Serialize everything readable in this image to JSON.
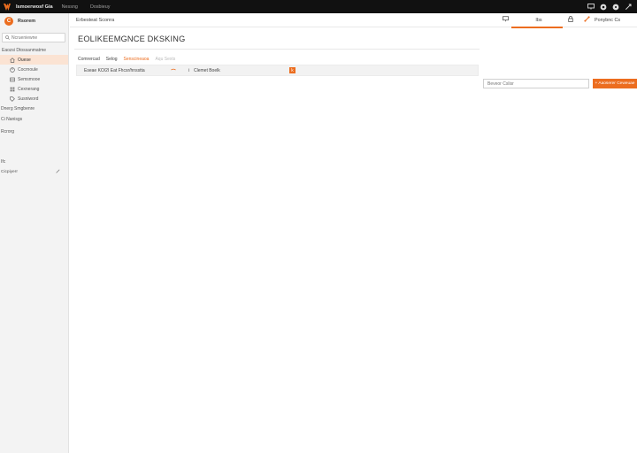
{
  "topbar": {
    "app_title": "Ismoerwosf Gia",
    "links": [
      "Nessng",
      "Dosbieuy"
    ],
    "icons": [
      "monitor-icon",
      "globe-icon",
      "help-icon",
      "settings-icon"
    ]
  },
  "sidebar": {
    "workspace_initial": "C",
    "workspace_name": "Rsorem",
    "search_placeholder": "Ncrueniewne",
    "section_title": "Eaozsi Dtossanmatme",
    "items": [
      {
        "label": "Ouese",
        "icon": "home-icon"
      },
      {
        "label": "Cocrnoule",
        "icon": "chart-icon"
      },
      {
        "label": "Semsmooe",
        "icon": "layers-icon"
      },
      {
        "label": "Cexnerang",
        "icon": "grid-icon"
      },
      {
        "label": "Susniword",
        "icon": "tag-icon"
      }
    ],
    "rows": [
      "Dnerg Smgbenre",
      "Ci Nanisgs",
      "Rcrorg"
    ],
    "bottom_label": "Ifc",
    "bottom_row_label": "Cicpiyerr"
  },
  "main": {
    "breadcrumb": "Erbesteat Sconra",
    "tabs": [
      {
        "label": "Ibs"
      },
      {
        "label": "Ponybnc Cs"
      }
    ],
    "title": "EOLIKEEMGNCE DKSKING",
    "filters": [
      "Comrercad",
      "Selog",
      "Senscineaoa",
      "Aqu Sexts"
    ],
    "result": {
      "name": "Eseae KO/2I Eat Fhcsr/hnsstta",
      "info_glyph": "i",
      "status": "Clemet Boelk",
      "flag": "k"
    },
    "input_placeholder": "Beveor Cslisr",
    "cta_label": "+ Aaoserer Ceweuae"
  },
  "colors": {
    "accent": "#ec6d1f",
    "topbar": "#111111",
    "sidebar": "#f3f3f3",
    "active_item": "#fbe3d3"
  }
}
